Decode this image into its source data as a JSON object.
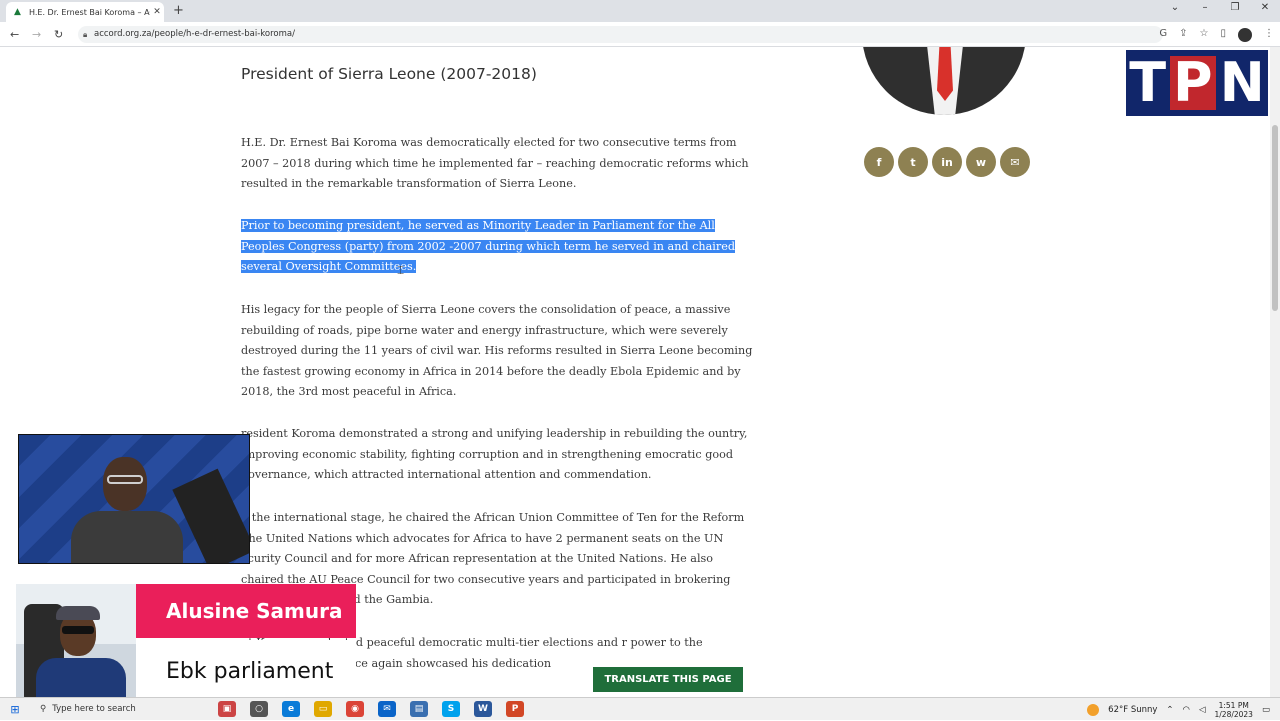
{
  "browser": {
    "tab_title": "H.E. Dr. Ernest Bai Koroma – ACC",
    "tab_close": "✕",
    "new_tab": "+",
    "url": "accord.org.za/people/h-e-dr-ernest-bai-koroma/"
  },
  "page": {
    "title": "President of Sierra Leone (2007-2018)",
    "paragraphs": [
      " H.E. Dr. Ernest Bai Koroma was democratically elected for two consecutive terms from 2007 – 2018 during which time he implemented far – reaching democratic reforms which resulted in the remarkable transformation of Sierra Leone.",
      "Prior to becoming president, he served as Minority Leader in Parliament for the All Peoples Congress (party) from 2002 -2007 during which term he served in and chaired several Oversight Committees.",
      "His legacy for the people of Sierra Leone covers the consolidation of peace, a massive rebuilding of roads, pipe borne water and energy infrastructure, which were severely destroyed during the 11 years of civil war. His reforms resulted in Sierra Leone becoming the fastest growing economy in Africa in 2014 before the deadly Ebola Epidemic and by 2018, the 3rd most peaceful in Africa.",
      "resident Koroma demonstrated a strong and unifying leadership in rebuilding the ountry, improving economic stability, fighting corruption and in strengthening emocratic good governance, which attracted international attention and commendation.",
      "n the international stage, he chaired the African Union Committee of Ten for the Reform The United Nations which advocates for Africa to have 2 permanent seats on the UN ecurity Council and for more African representation at the United Nations. He also chaired the AU Peace Council for two consecutive years and participated in brokering peace in Cote au and the Gambia.",
      "nt Koroma conducted peaceful democratic multi-tier elections and r power to the opposition which once again showcased his dedication"
    ],
    "share_icons": [
      "f",
      "t",
      "in",
      "w",
      "✉"
    ],
    "translate_button": "TRANSLATE THIS PAGE"
  },
  "overlay": {
    "logo_letters": [
      "T",
      "P",
      "N"
    ],
    "lower_third_name": "Alusine Samura",
    "lower_third_sub": "Ebk parliament"
  },
  "taskbar": {
    "search_placeholder": "Type here to search",
    "weather": "62°F  Sunny",
    "time": "1:51 PM",
    "date": "1/28/2023"
  }
}
